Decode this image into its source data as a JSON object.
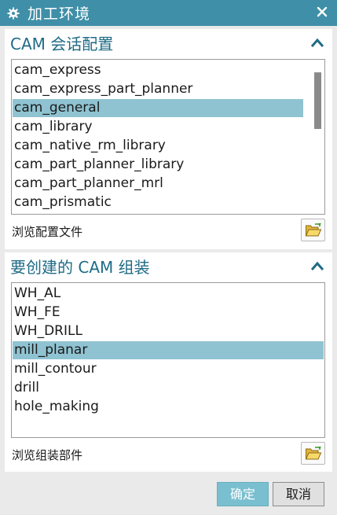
{
  "window": {
    "title": "加工环境"
  },
  "session_config": {
    "title": "CAM 会话配置",
    "items": [
      {
        "label": "cam_express",
        "selected": false
      },
      {
        "label": "cam_express_part_planner",
        "selected": false
      },
      {
        "label": "cam_general",
        "selected": true
      },
      {
        "label": "cam_library",
        "selected": false
      },
      {
        "label": "cam_native_rm_library",
        "selected": false
      },
      {
        "label": "cam_part_planner_library",
        "selected": false
      },
      {
        "label": "cam_part_planner_mrl",
        "selected": false
      },
      {
        "label": "cam_prismatic",
        "selected": false
      }
    ],
    "browse_label": "浏览配置文件"
  },
  "setup": {
    "title": "要创建的 CAM 组装",
    "items": [
      {
        "label": "WH_AL",
        "selected": false
      },
      {
        "label": "WH_FE",
        "selected": false
      },
      {
        "label": "WH_DRILL",
        "selected": false
      },
      {
        "label": "mill_planar",
        "selected": true
      },
      {
        "label": "mill_contour",
        "selected": false
      },
      {
        "label": "drill",
        "selected": false
      },
      {
        "label": "hole_making",
        "selected": false
      }
    ],
    "browse_label": "浏览组装部件"
  },
  "buttons": {
    "ok": "确定",
    "cancel": "取消"
  },
  "icons": {
    "title": "gear-icon",
    "close": "close-icon",
    "collapse": "chevron-up-icon",
    "browse": "folder-open-icon"
  },
  "colors": {
    "titlebar": "#3f8fa8",
    "section_title": "#1f6b86",
    "selection": "#8fc3d1",
    "ok_button": "#79bfd0"
  }
}
